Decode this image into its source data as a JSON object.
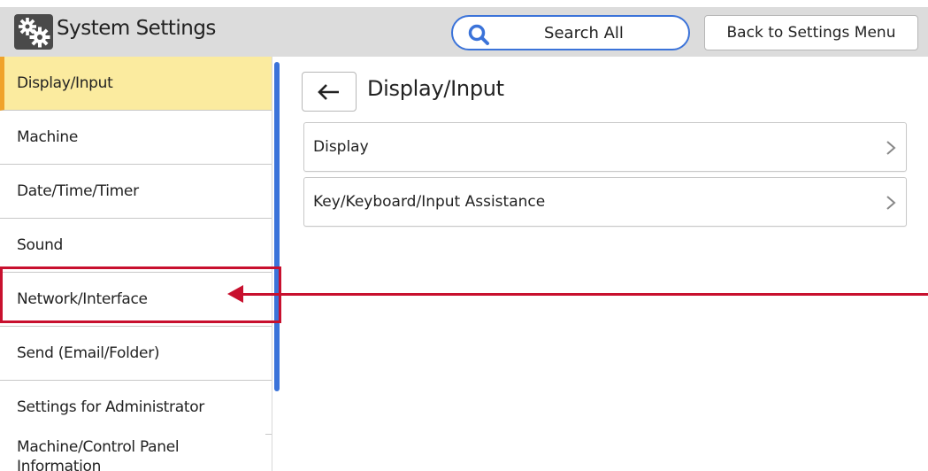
{
  "header": {
    "title": "System Settings",
    "app_icon": "gears-icon",
    "search_label": "Search All",
    "search_icon": "search-icon",
    "back_menu_label": "Back to Settings Menu"
  },
  "sidebar": {
    "items": [
      {
        "label": "Display/Input",
        "selected": true
      },
      {
        "label": "Machine"
      },
      {
        "label": "Date/Time/Timer"
      },
      {
        "label": "Sound"
      },
      {
        "label": "Network/Interface",
        "highlighted": true
      },
      {
        "label": "Send (Email/Folder)"
      },
      {
        "label": "Settings for Administrator"
      },
      {
        "label": "Machine/Control Panel Information"
      }
    ]
  },
  "main": {
    "back_icon": "arrow-left-icon",
    "title": "Display/Input",
    "rows": [
      {
        "label": "Display"
      },
      {
        "label": "Key/Keyboard/Input Assistance"
      }
    ]
  },
  "colors": {
    "accent_blue": "#3b73d9",
    "selected_bg": "#fbeb9f",
    "selected_marker": "#f0a32a",
    "annotation_red": "#c8102e",
    "header_bg": "#dcdcdc"
  }
}
